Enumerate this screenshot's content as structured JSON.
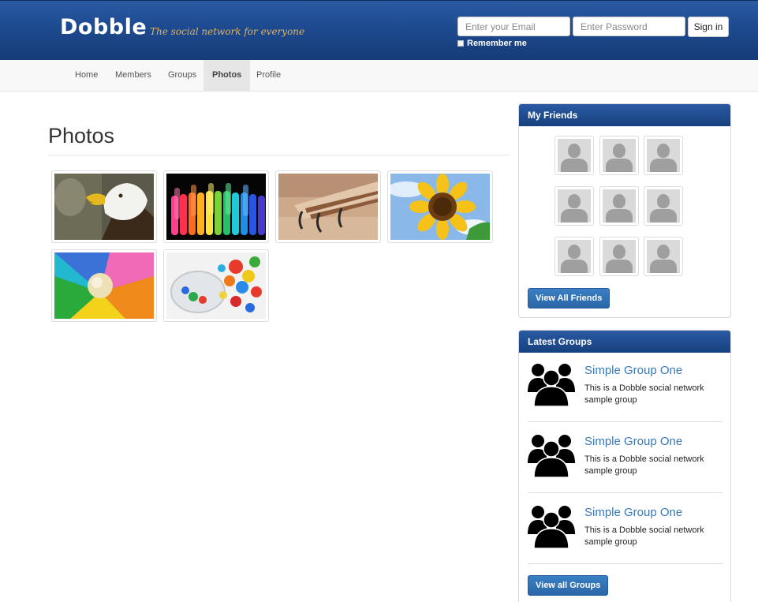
{
  "header": {
    "logo": "Dobble",
    "tagline": "The social network for everyone",
    "email_placeholder": "Enter your Email",
    "password_placeholder": "Enter Password",
    "signin_label": "Sign in",
    "remember_label": "Remember me",
    "brand_color": "#1d4a8f"
  },
  "nav": {
    "items": [
      {
        "label": "Home"
      },
      {
        "label": "Members"
      },
      {
        "label": "Groups"
      },
      {
        "label": "Photos",
        "active": true
      },
      {
        "label": "Profile"
      }
    ]
  },
  "main": {
    "title": "Photos",
    "photos": [
      {
        "subject": "bald eagle"
      },
      {
        "subject": "rainbow test tubes"
      },
      {
        "subject": "park bench"
      },
      {
        "subject": "sunflower"
      },
      {
        "subject": "rainbow pinwheel with ball"
      },
      {
        "subject": "colorful marbles in jar"
      }
    ]
  },
  "friends_panel": {
    "title": "My Friends",
    "friend_count": 9,
    "button_label": "View All Friends"
  },
  "groups_panel": {
    "title": "Latest Groups",
    "groups": [
      {
        "name": "Simple Group One",
        "description": "This is a Dobble social network sample group"
      },
      {
        "name": "Simple Group One",
        "description": "This is a Dobble social network sample group"
      },
      {
        "name": "Simple Group One",
        "description": "This is a Dobble social network sample group"
      }
    ],
    "button_label": "View all Groups"
  }
}
